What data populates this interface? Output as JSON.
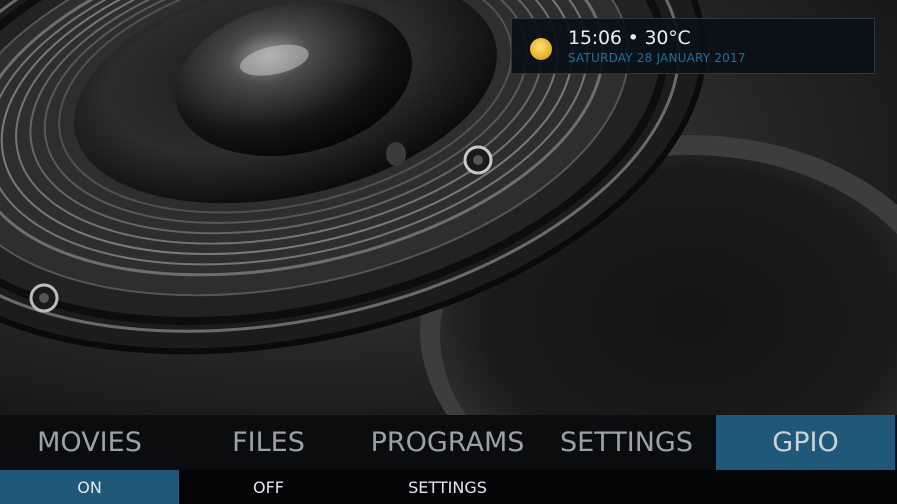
{
  "weather": {
    "time_temp": "15:06 • 30°C",
    "date": "SATURDAY 28 JANUARY 2017",
    "icon": "sun-icon"
  },
  "main_menu": {
    "items": [
      {
        "label": "MOVIES"
      },
      {
        "label": "FILES"
      },
      {
        "label": "PROGRAMS"
      },
      {
        "label": "SETTINGS"
      },
      {
        "label": "GPIO"
      }
    ],
    "active": "GPIO"
  },
  "sub_menu": {
    "items": [
      {
        "label": "ON"
      },
      {
        "label": "OFF"
      },
      {
        "label": "SETTINGS"
      }
    ],
    "active": "ON"
  },
  "colors": {
    "accent": "#1f5878",
    "date_text": "#1f6f99",
    "menu_text": "#9aa2a8",
    "sun": "#f2c230"
  },
  "background": "speaker-photo"
}
